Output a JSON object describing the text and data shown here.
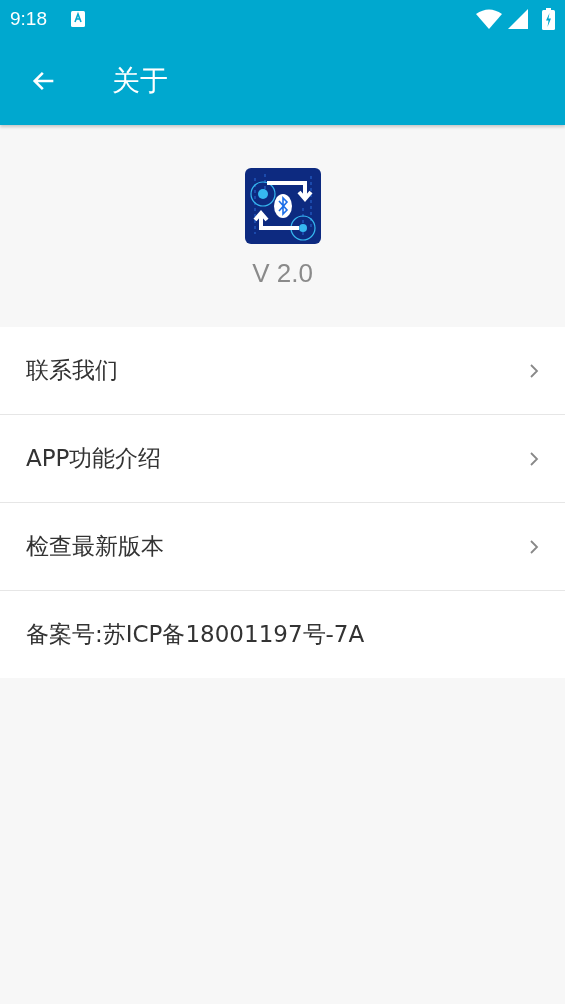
{
  "status_bar": {
    "time": "9:18"
  },
  "toolbar": {
    "title": "关于"
  },
  "app": {
    "version": "V 2.0"
  },
  "items": [
    {
      "kind": "link",
      "label": "联系我们"
    },
    {
      "kind": "link",
      "label": "APP功能介绍"
    },
    {
      "kind": "link",
      "label": "检查最新版本"
    },
    {
      "kind": "text",
      "label": "备案号:苏ICP备18001197号-7A"
    }
  ]
}
